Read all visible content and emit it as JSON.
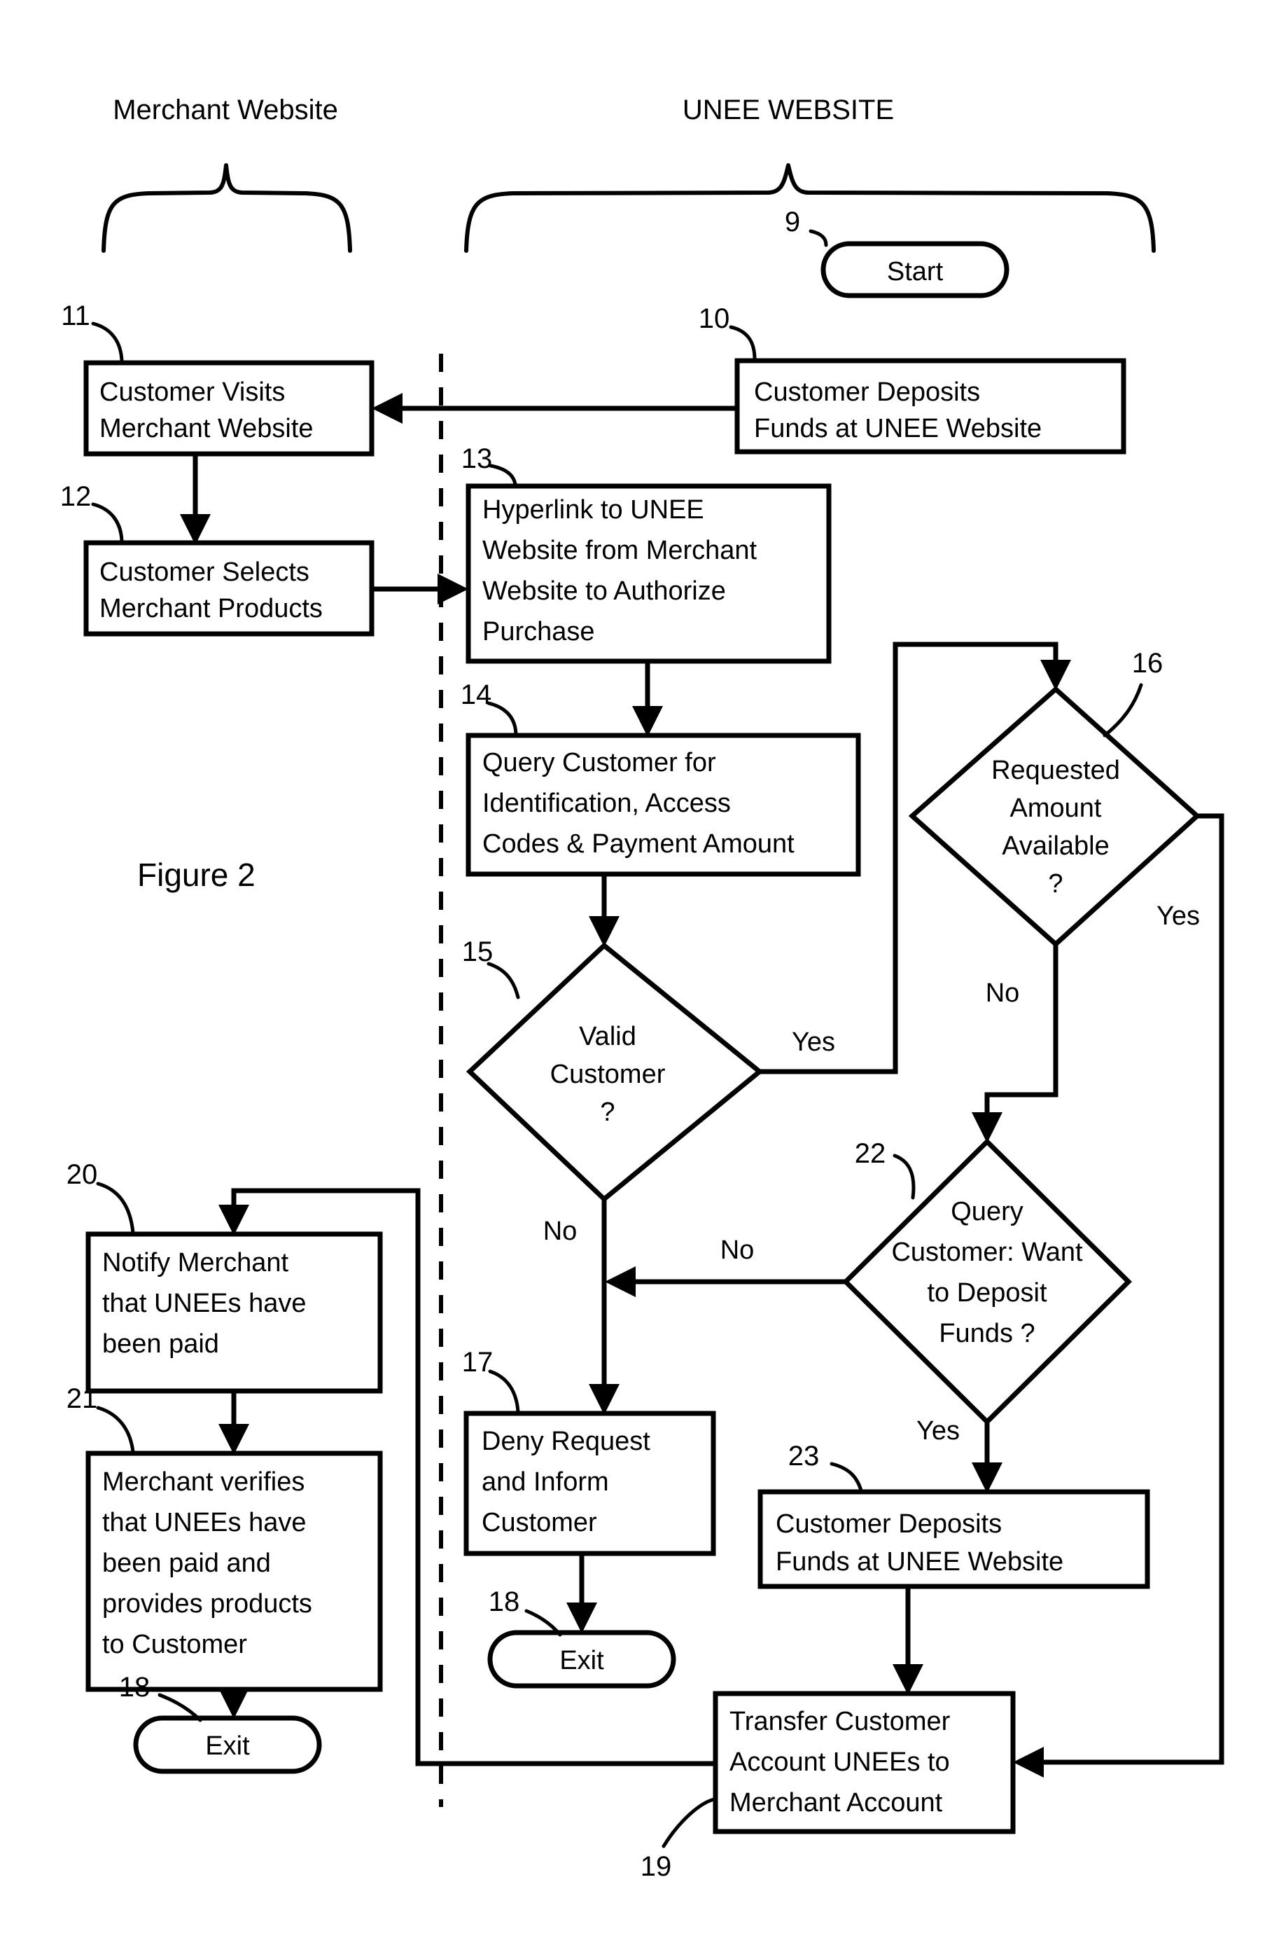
{
  "figure": {
    "label": "Figure 2",
    "headers": {
      "left": "Merchant Website",
      "right": "UNEE WEBSITE"
    }
  },
  "nodes": {
    "start": {
      "ref": "9",
      "text": "Start",
      "shape": "terminator"
    },
    "n10": {
      "ref": "10",
      "lines": [
        "Customer Deposits",
        "Funds at UNEE Website"
      ],
      "shape": "process"
    },
    "n11": {
      "ref": "11",
      "lines": [
        "Customer Visits",
        "Merchant Website"
      ],
      "shape": "process"
    },
    "n12": {
      "ref": "12",
      "lines": [
        "Customer Selects",
        "Merchant Products"
      ],
      "shape": "process"
    },
    "n13": {
      "ref": "13",
      "lines": [
        "Hyperlink to UNEE",
        "Website from  Merchant",
        "Website to Authorize",
        "Purchase"
      ],
      "shape": "process"
    },
    "n14": {
      "ref": "14",
      "lines": [
        "Query Customer for",
        "Identification, Access",
        "Codes & Payment Amount"
      ],
      "shape": "process"
    },
    "n15": {
      "ref": "15",
      "lines": [
        "Valid",
        "Customer",
        "?"
      ],
      "shape": "decision"
    },
    "n16": {
      "ref": "16",
      "lines": [
        "Requested",
        "Amount",
        "Available",
        "?"
      ],
      "shape": "decision"
    },
    "n17": {
      "ref": "17",
      "lines": [
        "Deny Request",
        "and Inform",
        "Customer"
      ],
      "shape": "process"
    },
    "n18a": {
      "ref": "18",
      "text": "Exit",
      "shape": "terminator"
    },
    "n18b": {
      "ref": "18",
      "text": "Exit",
      "shape": "terminator"
    },
    "n19": {
      "ref": "19",
      "lines": [
        "Transfer Customer",
        "Account UNEEs to",
        "Merchant Account"
      ],
      "shape": "process"
    },
    "n20": {
      "ref": "20",
      "lines": [
        "Notify Merchant",
        "that UNEEs have",
        "been paid"
      ],
      "shape": "process"
    },
    "n21": {
      "ref": "21",
      "lines": [
        "Merchant verifies",
        "that UNEEs have",
        "been paid and",
        "provides products",
        "to Customer"
      ],
      "shape": "process"
    },
    "n22": {
      "ref": "22",
      "lines": [
        "Query",
        "Customer: Want",
        "to Deposit",
        "Funds ?"
      ],
      "shape": "decision"
    },
    "n23": {
      "ref": "23",
      "lines": [
        "Customer Deposits",
        "Funds at UNEE Website"
      ],
      "shape": "process"
    }
  },
  "branch_labels": {
    "valid_customer_yes": "Yes",
    "valid_customer_no": "No",
    "amount_available_yes": "Yes",
    "amount_available_no": "No",
    "deposit_query_no": "No",
    "deposit_query_yes": "Yes"
  },
  "colors": {
    "ink": "#000000",
    "paper": "#ffffff"
  }
}
